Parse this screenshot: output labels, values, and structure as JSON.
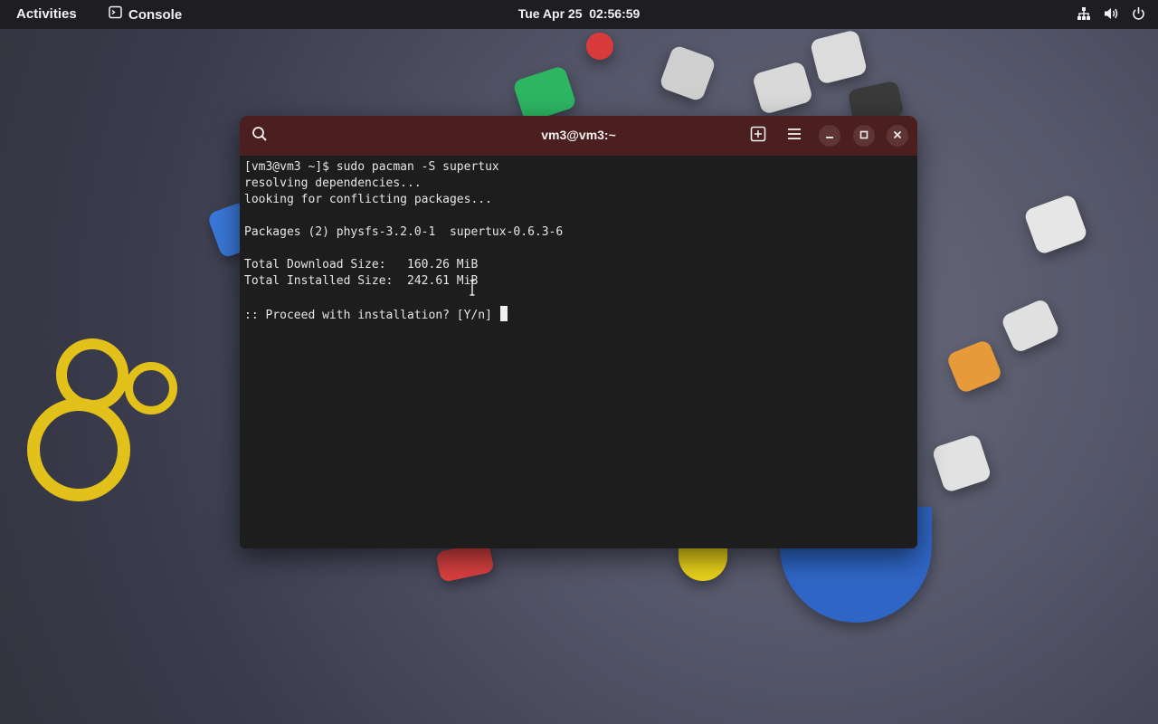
{
  "topbar": {
    "activities": "Activities",
    "app_name": "Console",
    "date": "Tue Apr 25",
    "time": "02:56:59",
    "status_icons": [
      "network-icon",
      "volume-icon",
      "power-icon"
    ]
  },
  "window": {
    "title": "vm3@vm3:~",
    "buttons": [
      "search-icon",
      "new-tab-icon",
      "menu-icon",
      "minimize-icon",
      "maximize-icon",
      "close-icon"
    ],
    "titlebar_color": "#4b1f1f",
    "background_color": "#1d1d1d"
  },
  "terminal": {
    "lines": [
      "[vm3@vm3 ~]$ sudo pacman -S supertux",
      "resolving dependencies...",
      "looking for conflicting packages...",
      "",
      "Packages (2) physfs-3.2.0-1  supertux-0.6.3-6",
      "",
      "Total Download Size:   160.26 MiB",
      "Total Installed Size:  242.61 MiB",
      "",
      ":: Proceed with installation? [Y/n] "
    ]
  }
}
